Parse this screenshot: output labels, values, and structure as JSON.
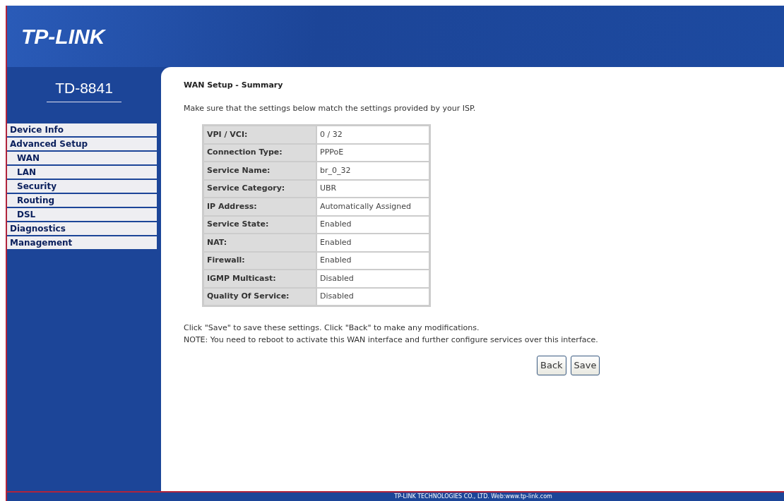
{
  "header": {
    "brand": "TP-LINK",
    "model": "TD-8841"
  },
  "sidebar": {
    "items": [
      {
        "label": "Device Info"
      },
      {
        "label": "Advanced Setup",
        "children": [
          {
            "label": "WAN"
          },
          {
            "label": "LAN"
          },
          {
            "label": "Security"
          },
          {
            "label": "Routing"
          },
          {
            "label": "DSL"
          }
        ]
      },
      {
        "label": "Diagnostics"
      },
      {
        "label": "Management"
      }
    ]
  },
  "page": {
    "title": "WAN Setup - Summary",
    "intro": "Make sure that the settings below match the settings provided by your ISP.",
    "rows": [
      {
        "label": "VPI / VCI:",
        "value": "0 / 32"
      },
      {
        "label": "Connection Type:",
        "value": "PPPoE"
      },
      {
        "label": "Service Name:",
        "value": "br_0_32"
      },
      {
        "label": "Service Category:",
        "value": "UBR"
      },
      {
        "label": "IP Address:",
        "value": "Automatically Assigned"
      },
      {
        "label": "Service State:",
        "value": "Enabled"
      },
      {
        "label": "NAT:",
        "value": "Enabled"
      },
      {
        "label": "Firewall:",
        "value": "Enabled"
      },
      {
        "label": "IGMP Multicast:",
        "value": "Disabled"
      },
      {
        "label": "Quality Of Service:",
        "value": "Disabled"
      }
    ],
    "notes": [
      "Click \"Save\" to save these settings. Click \"Back\" to make any modifications.",
      "NOTE: You need to reboot to activate this WAN interface and further configure services over this interface."
    ],
    "buttons": [
      "Back",
      "Save"
    ]
  },
  "footer": "TP-LINK TECHNOLOGIES CO., LTD. Web:www.tp-link.com"
}
